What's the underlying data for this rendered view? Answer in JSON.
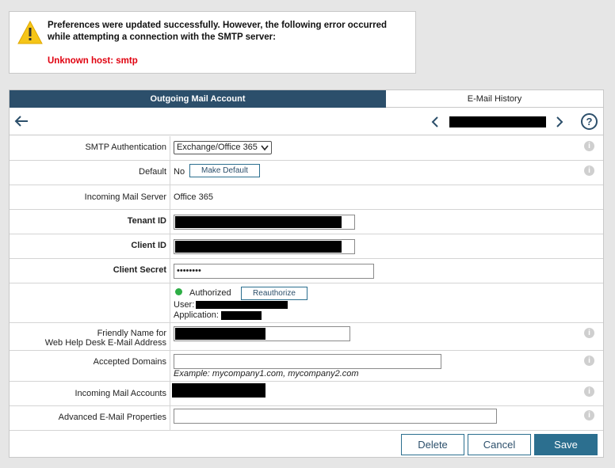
{
  "alert": {
    "message": "Preferences were updated successfully. However, the following error occurred while attempting a connection with the SMTP server:",
    "error": "Unknown host: smtp",
    "icon": "warning-icon"
  },
  "tabs": [
    {
      "label": "Outgoing Mail Account",
      "active": true
    },
    {
      "label": "E-Mail History",
      "active": false
    }
  ],
  "nav": {
    "help_label": "?"
  },
  "form": {
    "smtp_auth": {
      "label": "SMTP Authentication",
      "value": "Exchange/Office 365"
    },
    "default": {
      "label": "Default",
      "value": "No",
      "button": "Make Default"
    },
    "incoming_server": {
      "label": "Incoming Mail Server",
      "value": "Office 365"
    },
    "tenant_id": {
      "label": "Tenant ID"
    },
    "client_id": {
      "label": "Client ID"
    },
    "client_secret": {
      "label": "Client Secret",
      "value": "••••••••"
    },
    "auth": {
      "status": "Authorized",
      "button": "Reauthorize",
      "user_label": "User:",
      "application_label": "Application:"
    },
    "friendly_name": {
      "label_line1": "Friendly Name for",
      "label_line2": "Web Help Desk E-Mail Address"
    },
    "accepted_domains": {
      "label": "Accepted Domains",
      "hint": "Example: mycompany1.com, mycompany2.com"
    },
    "incoming_accounts": {
      "label": "Incoming Mail Accounts"
    },
    "advanced": {
      "label": "Advanced E-Mail Properties"
    }
  },
  "footer": {
    "delete": "Delete",
    "cancel": "Cancel",
    "save": "Save"
  },
  "colors": {
    "accent": "#2c4f6b",
    "button": "#2c6f8f",
    "error": "#e0000f",
    "success": "#2eae46"
  }
}
